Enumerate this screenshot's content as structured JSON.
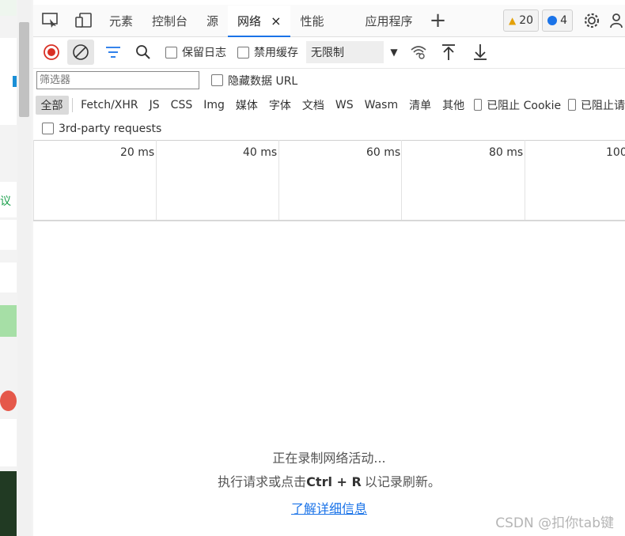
{
  "tabs": {
    "items": [
      "元素",
      "控制台",
      "源",
      "网络",
      "性能",
      "应用程序"
    ],
    "active_close": "×",
    "warnings": "20",
    "messages": "4"
  },
  "toolbar": {
    "preserve_log": "保留日志",
    "disable_cache": "禁用缓存",
    "throttle": "无限制"
  },
  "filter": {
    "placeholder": "筛选器",
    "hide_data_urls": "隐藏数据 URL"
  },
  "types": [
    "全部",
    "Fetch/XHR",
    "JS",
    "CSS",
    "Img",
    "媒体",
    "字体",
    "文档",
    "WS",
    "Wasm",
    "清单",
    "其他"
  ],
  "blocked_cookies": "已阻止 Cookie",
  "blocked_requests": "已阻止请",
  "third_party": "3rd-party requests",
  "timeline": [
    "20 ms",
    "40 ms",
    "60 ms",
    "80 ms",
    "100"
  ],
  "empty": {
    "recording": "正在录制网络活动...",
    "hint_pre": "执行请求或点击",
    "hint_key": "Ctrl + R",
    "hint_post": "以记录刷新。",
    "learn_more": "了解详细信息"
  },
  "watermark": "CSDN @扣你tab键",
  "colors": {
    "accent": "#1a73e8",
    "record": "#d93025",
    "link": "#1a73e8"
  }
}
